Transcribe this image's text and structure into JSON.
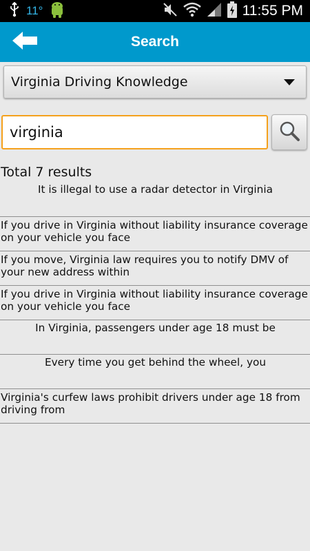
{
  "status_bar": {
    "temperature": "11°",
    "time": "11:55 PM",
    "icons": [
      "usb-icon",
      "android-icon",
      "mute-icon",
      "wifi-icon",
      "signal-icon",
      "battery-icon"
    ]
  },
  "app_bar": {
    "title": "Search",
    "back_icon": "back-arrow-icon",
    "color": "#0099cc"
  },
  "category_spinner": {
    "selected": "Virginia Driving Knowledge"
  },
  "search": {
    "value": "virginia",
    "focus_color": "#f5a11c",
    "button_icon": "magnifier-icon"
  },
  "results_total": "Total 7 results",
  "results": [
    {
      "text": "It is illegal to use a radar detector in Virginia",
      "align": "center"
    },
    {
      "text": "If you drive in Virginia without liability insurance coverage on your vehicle you face",
      "align": "left"
    },
    {
      "text": "If you move, Virginia law requires you to notify DMV of your new address within",
      "align": "left"
    },
    {
      "text": "If you drive in Virginia without liability insurance coverage on your vehicle you face",
      "align": "left"
    },
    {
      "text": "In Virginia, passengers under age 18 must be",
      "align": "center"
    },
    {
      "text": "Every time you get behind the wheel, you",
      "align": "center"
    },
    {
      "text": "Virginia's curfew laws prohibit drivers under age 18 from driving from",
      "align": "left"
    }
  ]
}
